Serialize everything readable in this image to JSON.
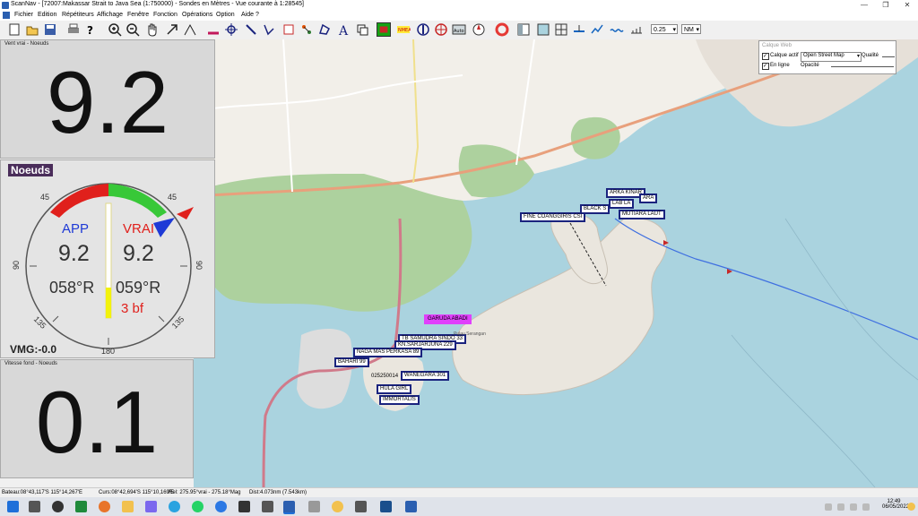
{
  "window": {
    "title": "ScanNav - [72007:Makassar Strait to Java Sea (1:750000) - Sondes en  Mètres - Vue courante à 1:28545]"
  },
  "menu": [
    "Fichier",
    "Edition",
    "Répétiteurs",
    "Affichage",
    "Fenêtre",
    "Fonction",
    "Opérations",
    "Option",
    "Aide ?"
  ],
  "toolbar": {
    "zoom_value": "0.25",
    "unit_value": "NM",
    "sel_tool": "nav-icon"
  },
  "panels": {
    "wind": {
      "title": "Vent vrai - Noeuds",
      "value": "9.2"
    },
    "gauge": {
      "title": "Noeuds",
      "app_label": "APP",
      "true_label": "VRAI",
      "app_speed": "9.2",
      "true_speed": "9.2",
      "app_dir": "058°R",
      "true_dir": "059°R",
      "beaufort": "3 bf",
      "vmg": "VMG:-0.0",
      "scale_45_left": "45",
      "scale_45_right": "45",
      "scale_90_left": "90",
      "scale_90_right": "90",
      "scale_135_left": "135",
      "scale_135_right": "135",
      "scale_180": "180"
    },
    "sog": {
      "title": "Vitesse fond - Noeuds",
      "value": "0.1"
    }
  },
  "webpanel": {
    "title": "Calque Web",
    "active_label": "Calque actif",
    "source": "Open Street Map",
    "quality_label": "Qualité",
    "online_label": "En ligne",
    "opacity_label": "Opacité"
  },
  "map_labels": {
    "l1": "ARKA KINAR",
    "l2": "ARA",
    "l3": "LAB LA",
    "l4": "BLACK S",
    "l5": "MUTIARA LAUT",
    "l6": "FINE COANGGIRIS CSI",
    "l7": "GARUDA ABADI",
    "l8": "TB SAMUDRA SINDO 33",
    "l9": "KN.SARJARJUNA 229",
    "l10": "NAGA MAS PERKASA 89",
    "l11": "BAHARI 99",
    "l12": "WANEGARA 301",
    "l13": "025250014",
    "l14": "HULA GIRL",
    "l15": "IMMORTALIS",
    "place": "Pulau Serangan"
  },
  "statusbar": {
    "boat": "Bateau:08°43,117'S 115°14,267'E",
    "cursor": "Curs:08°42,694'S 115°10,169'E",
    "rel": "Rel: 275.95°vrai - 275.18°Mag",
    "dist": "Dist:4.073nm (7.543km)"
  },
  "taskbar": {
    "time": "12:49",
    "date": "06/05/2022"
  },
  "colors": {
    "sea": "#aad3df",
    "land": "#f2efe9",
    "forest": "#add19e",
    "label_border": "#1a237e",
    "route": "#3f6fe0",
    "gauge_red": "#e0201c",
    "gauge_green": "#38c838",
    "gauge_yellow": "#f2f20c"
  }
}
